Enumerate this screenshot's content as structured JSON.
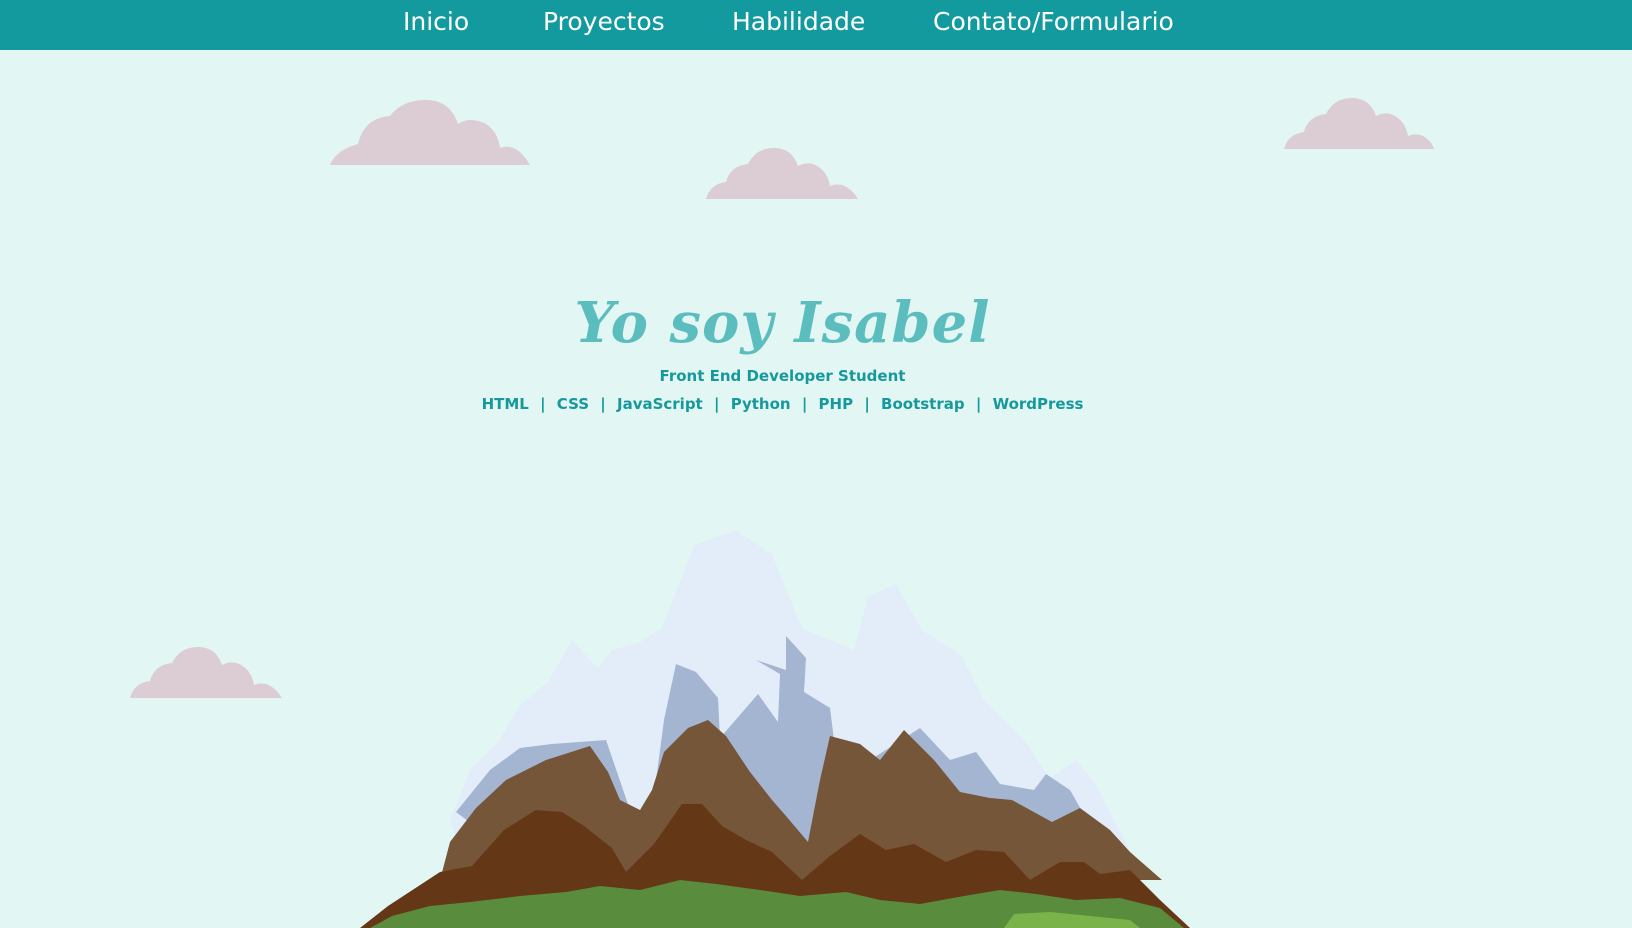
{
  "nav": {
    "items": [
      {
        "label": "Inicio"
      },
      {
        "label": "Proyectos"
      },
      {
        "label": "Habilidade"
      },
      {
        "label": "Contato/Formulario"
      }
    ]
  },
  "hero": {
    "title": "Yo soy Isabel",
    "subtitle": "Front End Developer Student",
    "skills": [
      "HTML",
      "CSS",
      "JavaScript",
      "Python",
      "PHP",
      "Bootstrap",
      "WordPress"
    ],
    "separator": "|"
  },
  "colors": {
    "nav_background": "#139a9f",
    "page_background": "#e2f7f4",
    "title": "#5cbdbe",
    "text_accent": "#17989b",
    "cloud": "#dcccd3",
    "snow": "#e3edf9",
    "snow_shadow": "#a3b5d0",
    "rock_light": "#765638",
    "rock_dark": "#643716",
    "grass": "#5a8c3e",
    "grass_light": "#7ab34a"
  },
  "decorations": {
    "clouds": [
      "cloud-illustration",
      "cloud-illustration",
      "cloud-illustration",
      "cloud-illustration"
    ],
    "mountain": "mountain-illustration"
  }
}
